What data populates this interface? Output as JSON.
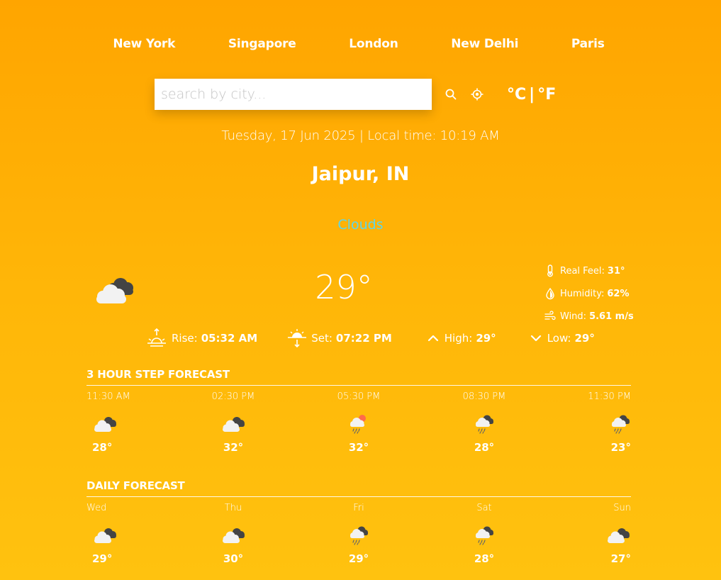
{
  "cities": [
    "New York",
    "Singapore",
    "London",
    "New Delhi",
    "Paris"
  ],
  "search": {
    "placeholder": "search by city...",
    "search_icon": "search-icon",
    "location_icon": "location-icon"
  },
  "units": {
    "celsius": "°C",
    "separator": "|",
    "fahrenheit": "°F"
  },
  "datetime": "Tuesday, 17 Jun 2025 | Local time: 10:19 AM",
  "location": "Jaipur, IN",
  "condition": "Clouds",
  "current": {
    "icon": "broken-clouds-icon",
    "temp": "29°",
    "details": [
      {
        "icon": "thermometer-icon",
        "label": "Real Feel:",
        "value": "31°"
      },
      {
        "icon": "humidity-icon",
        "label": "Humidity:",
        "value": "62%"
      },
      {
        "icon": "wind-icon",
        "label": "Wind:",
        "value": "5.61 m/s"
      }
    ],
    "sun": [
      {
        "icon": "sunrise-icon",
        "label": "Rise:",
        "value": "05:32 AM"
      },
      {
        "icon": "sunset-icon",
        "label": "Set:",
        "value": "07:22 PM"
      },
      {
        "icon": "chevron-up-icon",
        "label": "High:",
        "value": "29°"
      },
      {
        "icon": "chevron-down-icon",
        "label": "Low:",
        "value": "29°"
      }
    ]
  },
  "hourly": {
    "title": "3 HOUR STEP FORECAST",
    "items": [
      {
        "time": "11:30 AM",
        "icon": "broken-clouds-icon",
        "temp": "28°"
      },
      {
        "time": "02:30 PM",
        "icon": "broken-clouds-icon",
        "temp": "32°"
      },
      {
        "time": "05:30 PM",
        "icon": "sun-rain-icon",
        "temp": "32°"
      },
      {
        "time": "08:30 PM",
        "icon": "rain-cloud-icon",
        "temp": "28°"
      },
      {
        "time": "11:30 PM",
        "icon": "rain-cloud-icon",
        "temp": "23°"
      }
    ]
  },
  "daily": {
    "title": "DAILY FORECAST",
    "items": [
      {
        "time": "Wed",
        "icon": "broken-clouds-icon",
        "temp": "29°"
      },
      {
        "time": "Thu",
        "icon": "broken-clouds-icon",
        "temp": "30°"
      },
      {
        "time": "Fri",
        "icon": "rain-cloud-icon",
        "temp": "29°"
      },
      {
        "time": "Sat",
        "icon": "rain-cloud-icon",
        "temp": "28°"
      },
      {
        "time": "Sun",
        "icon": "broken-clouds-icon",
        "temp": "27°"
      }
    ]
  }
}
